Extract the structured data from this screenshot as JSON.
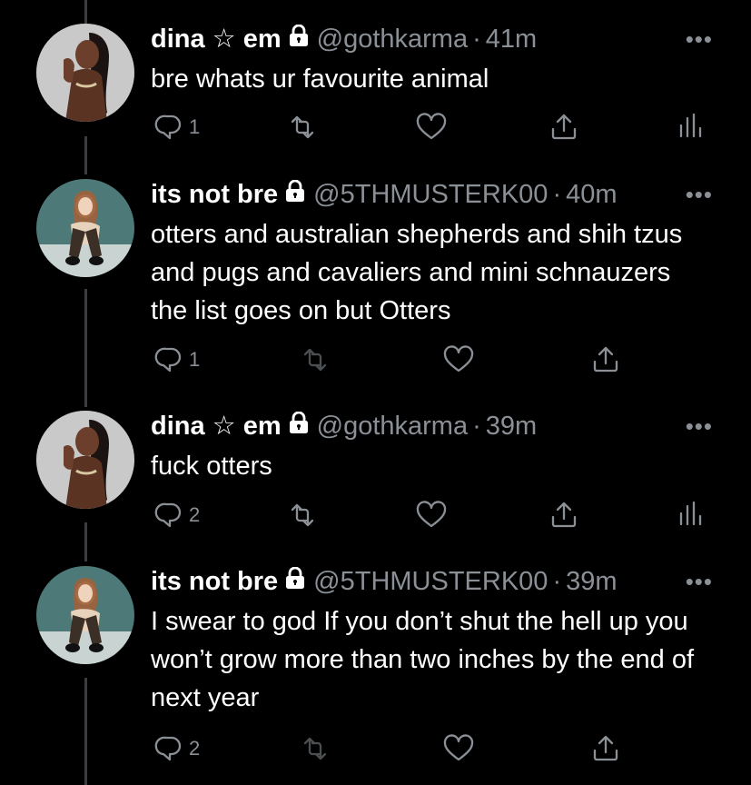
{
  "colors": {
    "background": "#000000",
    "text": "#ffffff",
    "muted": "#8b9096",
    "thread_line": "#3a3d41"
  },
  "tweets": [
    {
      "display_name": "dina ☆ em",
      "handle": "@gothkarma",
      "separator": "·",
      "time": "41m",
      "more_label": "•••",
      "text": "bre whats ur favourite animal",
      "reply_count": "1",
      "avatar": "avatar-dina",
      "icons": [
        "reply-icon",
        "retweet-icon",
        "like-icon",
        "share-icon",
        "analytics-icon"
      ]
    },
    {
      "display_name": "its not bre",
      "handle": "@5THMUSTERK00",
      "separator": "·",
      "time": "40m",
      "more_label": "•••",
      "text": "otters and australian shepherds and shih tzus and pugs and cavaliers and mini schnauzers the list goes on but Otters",
      "reply_count": "1",
      "avatar": "avatar-bre",
      "icons": [
        "reply-icon",
        "retweet-icon",
        "like-icon",
        "share-icon"
      ]
    },
    {
      "display_name": "dina ☆ em",
      "handle": "@gothkarma",
      "separator": "·",
      "time": "39m",
      "more_label": "•••",
      "text": "fuck otters",
      "reply_count": "2",
      "avatar": "avatar-dina",
      "icons": [
        "reply-icon",
        "retweet-icon",
        "like-icon",
        "share-icon",
        "analytics-icon"
      ]
    },
    {
      "display_name": "its not bre",
      "handle": "@5THMUSTERK00",
      "separator": "·",
      "time": "39m",
      "more_label": "•••",
      "text": "I swear to god If you don’t shut the hell up you won’t grow more than two inches by the end of next year",
      "reply_count": "2",
      "avatar": "avatar-bre",
      "icons": [
        "reply-icon",
        "retweet-icon",
        "like-icon",
        "share-icon"
      ]
    }
  ]
}
